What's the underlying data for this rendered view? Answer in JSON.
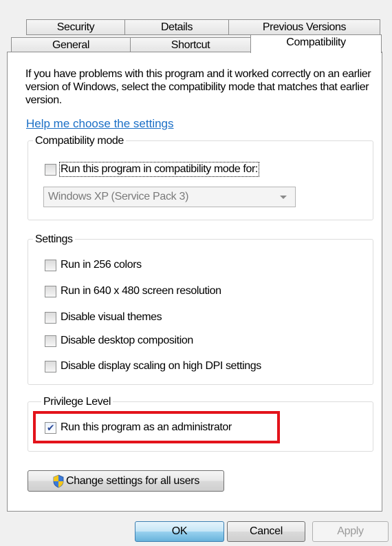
{
  "tabs": {
    "row1": [
      "Security",
      "Details",
      "Previous Versions"
    ],
    "row2": [
      "General",
      "Shortcut",
      "Compatibility"
    ],
    "active": "Compatibility"
  },
  "intro_text": "If you have problems with this program and it worked correctly on an earlier version of Windows, select the compatibility mode that matches that earlier version.",
  "help_link": "Help me choose the settings",
  "compat_mode": {
    "legend": "Compatibility mode",
    "checkbox_label": "Run this program in compatibility mode for:",
    "checked": false,
    "selected_os": "Windows XP (Service Pack 3)"
  },
  "settings": {
    "legend": "Settings",
    "items": [
      {
        "label": "Run in 256 colors",
        "checked": false
      },
      {
        "label": "Run in 640 x 480 screen resolution",
        "checked": false
      },
      {
        "label": "Disable visual themes",
        "checked": false
      },
      {
        "label": "Disable desktop composition",
        "checked": false
      },
      {
        "label": "Disable display scaling on high DPI settings",
        "checked": false
      }
    ]
  },
  "privilege": {
    "legend": "Privilege Level",
    "checkbox_label": "Run this program as an administrator",
    "checked": true
  },
  "change_all_users": "Change settings for all users",
  "buttons": {
    "ok": "OK",
    "cancel": "Cancel",
    "apply": "Apply"
  },
  "colors": {
    "highlight": "#e3131b",
    "link": "#1b6fc6"
  }
}
